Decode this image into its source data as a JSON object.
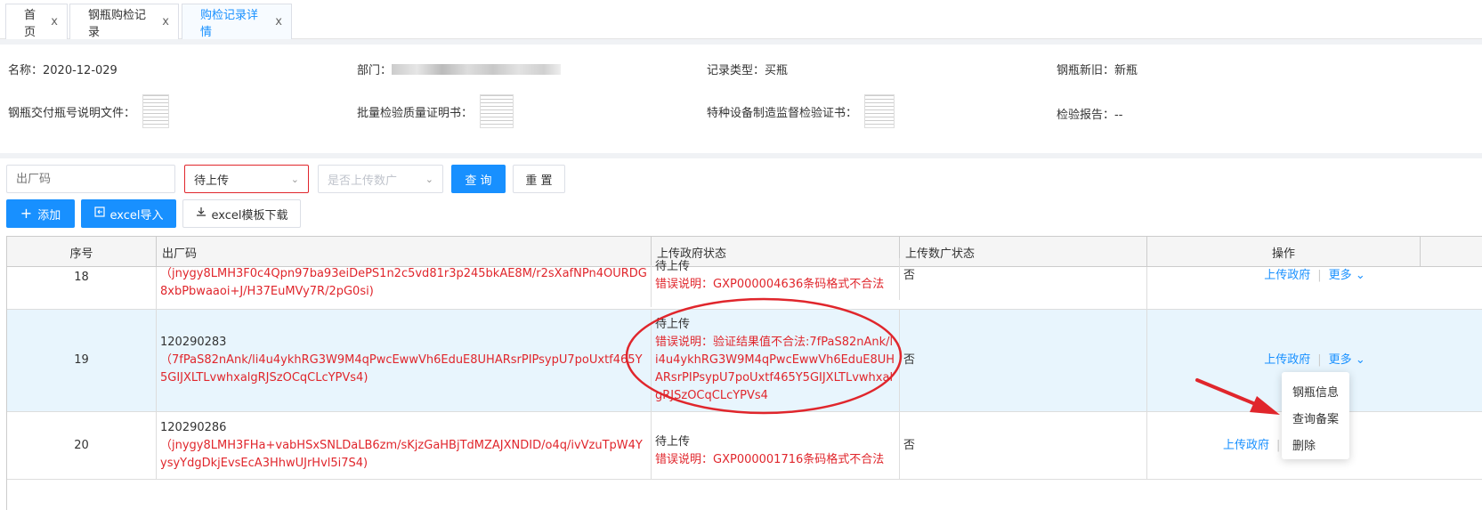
{
  "tabs": [
    {
      "label": "首页",
      "close": "x"
    },
    {
      "label": "钢瓶购检记录",
      "close": "x"
    },
    {
      "label": "购检记录详情",
      "close": "x"
    }
  ],
  "info": {
    "name": "名称：2020-12-029",
    "dept_label": "部门：",
    "record_type": "记录类型：买瓶",
    "cylinder_new_old": "钢瓶新旧：新瓶",
    "delivery_doc_label": "钢瓶交付瓶号说明文件：",
    "batch_cert_label": "批量检验质量证明书：",
    "special_cert_label": "特种设备制造监督检验证书：",
    "inspection_report": "检验报告：--"
  },
  "filters": {
    "factory_code_placeholder": "出厂码",
    "status_select": "待上传",
    "upload_select_placeholder": "是否上传数广",
    "query_label": "查 询",
    "reset_label": "重 置",
    "add_label": "添加",
    "excel_import_label": "excel导入",
    "excel_template_label": "excel模板下载"
  },
  "table": {
    "headers": [
      "序号",
      "出厂码",
      "上传政府状态",
      "上传数广状态",
      "操作"
    ],
    "rows": [
      {
        "index": "18",
        "code": "",
        "code_detail": "（jnygy8LMH3F0c4Qpn97ba93eiDePS1n2c5vd81r3p245bkAE8M/r2sXafNPn4OURDG8xbPbwaaoi+J/H37EuMVy7R/2pG0si)",
        "gov_status": "待上传",
        "gov_error": "错误说明：GXP000004636条码格式不合法",
        "sg_status": "否",
        "op_upload": "上传政府",
        "op_more": "更多"
      },
      {
        "index": "19",
        "code": "120290283",
        "code_detail": "（7fPaS82nAnk/li4u4ykhRG3W9M4qPwcEwwVh6EduE8UHARsrPIPsypU7poUxtf465Y5GIJXLTLvwhxalgRJSzOCqCLcYPVs4)",
        "gov_status": "待上传",
        "gov_error": "错误说明：验证结果值不合法:7fPaS82nAnk/li4u4ykhRG3W9M4qPwcEwwVh6EduE8UHARsrPIPsypU7poUxtf465Y5GIJXLTLvwhxalgRJSzOCqCLcYPVs4",
        "sg_status": "否",
        "op_upload": "上传政府",
        "op_more": "更多"
      },
      {
        "index": "20",
        "code": "120290286",
        "code_detail": "（jnygy8LMH3FHa+vabHSxSNLDaLB6zm/sKjzGaHBjTdMZAJXNDID/o4q/ivVzuTpW4YysyYdgDkjEvsEcA3HhwUJrHvl5i7S4)",
        "gov_status": "待上传",
        "gov_error": "错误说明：GXP000001716条码格式不合法",
        "sg_status": "否",
        "op_upload": "上传政府",
        "op_more": ""
      }
    ]
  },
  "more_menu": [
    "钢瓶信息",
    "查询备案",
    "删除"
  ],
  "colors": {
    "primary": "#1890ff",
    "error": "#e0262c",
    "selected_row": "#e8f5fd"
  }
}
